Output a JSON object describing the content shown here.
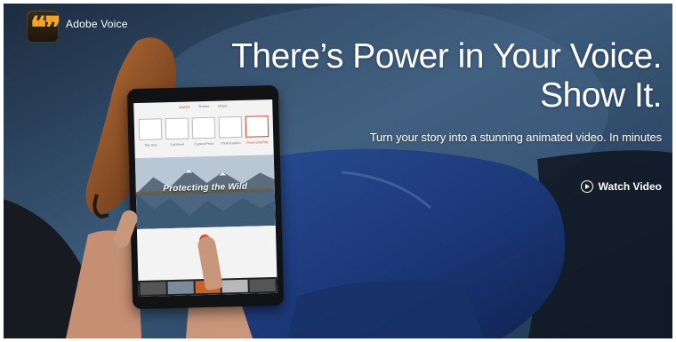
{
  "app": {
    "name": "Adobe Voice",
    "logo_glyph": "❝❞",
    "logo_color": "#f3a624"
  },
  "hero": {
    "headline_line1": "There’s Power in Your Voice.",
    "headline_line2": "Show It.",
    "subheadline": "Turn your story into a stunning animated video. In minutes",
    "watch_video_label": "Watch Video"
  },
  "tablet": {
    "tabs": [
      "Layout",
      "Theme",
      "Music"
    ],
    "active_tab": "Layout",
    "theme_labels": [
      "Title Only",
      "Full Bleed",
      "Caption/Photo",
      "Photo/Caption",
      "Photo Grid/Title"
    ],
    "photo_title": "Protecting the Wild"
  },
  "colors": {
    "accent": "#d44426",
    "denim": "#1b3a78",
    "background": "#2d4869"
  }
}
